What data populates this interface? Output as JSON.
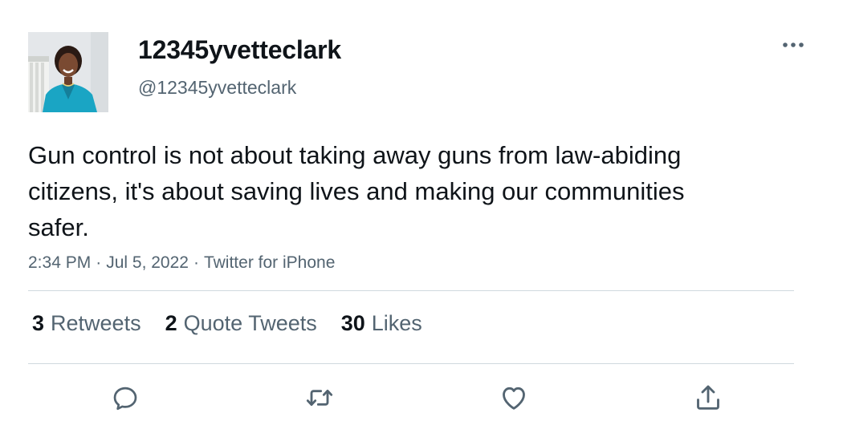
{
  "author": {
    "display_name": "12345yvetteclark",
    "handle": "@12345yvetteclark"
  },
  "tweet": {
    "text": "Gun control is not about taking away guns from law-abiding citizens, it's about saving lives and making our communities safer.",
    "time": "2:34 PM",
    "separator": "·",
    "date": "Jul 5, 2022",
    "source": "Twitter for iPhone"
  },
  "stats": {
    "retweets": {
      "count": "3",
      "label": "Retweets"
    },
    "quote_tweets": {
      "count": "2",
      "label": "Quote Tweets"
    },
    "likes": {
      "count": "30",
      "label": "Likes"
    }
  },
  "icons": {
    "more": "more-horizontal-icon",
    "reply": "reply-icon",
    "retweet": "retweet-icon",
    "like": "heart-icon",
    "share": "share-icon"
  },
  "colors": {
    "text_primary": "#0f1419",
    "text_secondary": "#536471",
    "divider": "#cfd9de",
    "icon": "#536471"
  }
}
